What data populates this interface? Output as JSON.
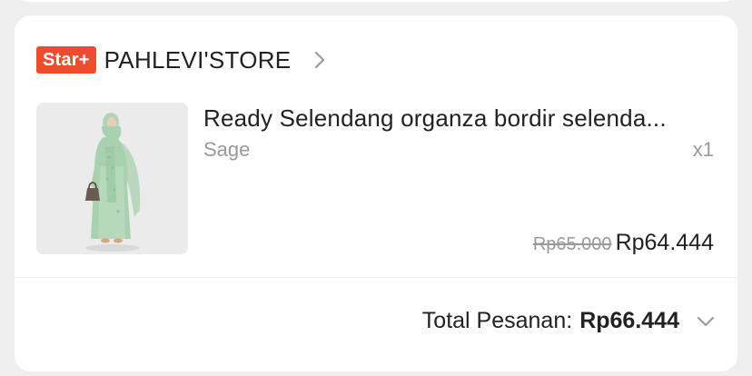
{
  "shop": {
    "badge": "Star+",
    "name": "PAHLEVI'STORE",
    "chevron_icon": "chevron-right-icon"
  },
  "product": {
    "title": "Ready Selendang organza bordir selenda...",
    "variant": "Sage",
    "quantity": "x1",
    "original_price": "Rp65.000",
    "price": "Rp64.444",
    "image_icon": "product-image"
  },
  "order": {
    "total_label": "Total Pesanan:",
    "total_value": "Rp66.444",
    "expand_icon": "chevron-down-icon"
  },
  "colors": {
    "badge": "#ee4d2d",
    "background": "#efefef",
    "card": "#ffffff",
    "muted_text": "#9a9a9a"
  }
}
